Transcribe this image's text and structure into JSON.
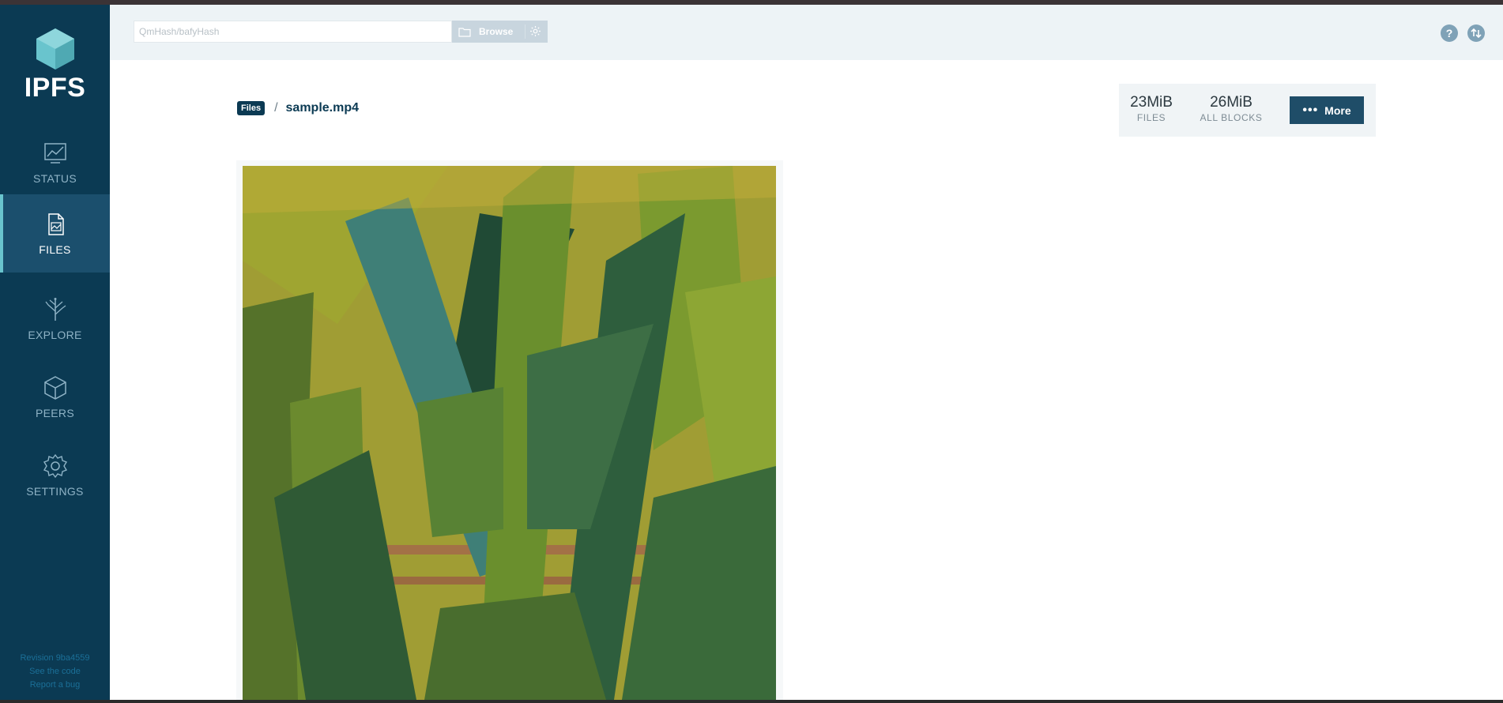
{
  "sidebar": {
    "logo_text": "IPFS",
    "items": [
      {
        "label": "STATUS",
        "icon": "status-icon"
      },
      {
        "label": "FILES",
        "icon": "files-icon"
      },
      {
        "label": "EXPLORE",
        "icon": "explore-icon"
      },
      {
        "label": "PEERS",
        "icon": "peers-icon"
      },
      {
        "label": "SETTINGS",
        "icon": "settings-icon"
      }
    ],
    "active": "FILES",
    "footer": {
      "revision": "Revision 9ba4559",
      "code_link": "See the code",
      "bug_link": "Report a bug"
    }
  },
  "header": {
    "search_placeholder": "QmHash/bafyHash",
    "browse_label": "Browse"
  },
  "breadcrumb": {
    "root": "Files",
    "current": "sample.mp4"
  },
  "stats": {
    "files_value": "23MiB",
    "files_label": "FILES",
    "blocks_value": "26MiB",
    "blocks_label": "ALL BLOCKS",
    "more_label": "More"
  },
  "colors": {
    "sidebar_bg": "#0b3a53",
    "accent": "#69c4cd",
    "header_bg": "#edf3f6",
    "button_bg": "#1f4d68"
  }
}
